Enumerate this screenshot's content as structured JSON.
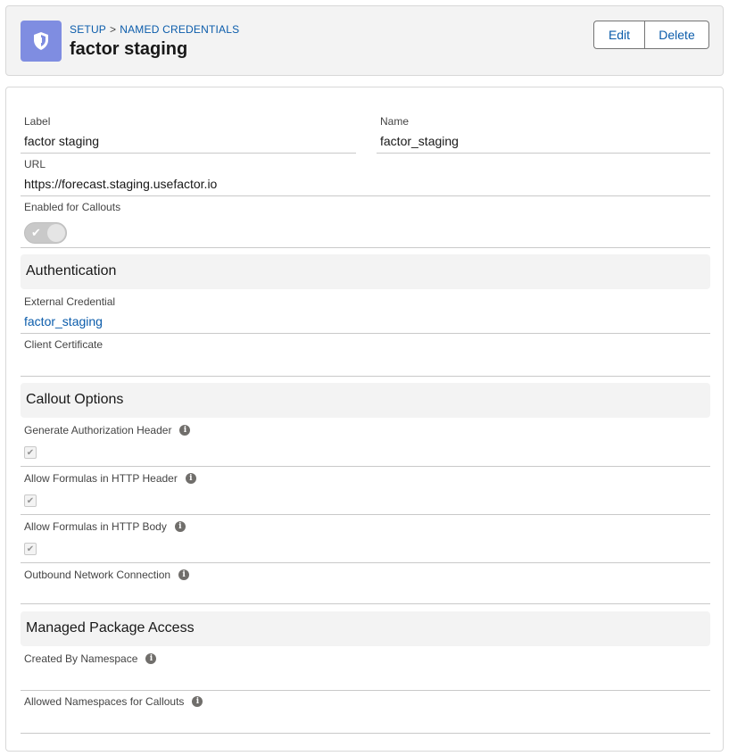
{
  "breadcrumb": {
    "setup": "SETUP",
    "separator": ">",
    "section": "NAMED CREDENTIALS"
  },
  "title": "factor staging",
  "buttons": {
    "edit": "Edit",
    "delete": "Delete"
  },
  "fields": {
    "label": {
      "label": "Label",
      "value": "factor staging"
    },
    "name": {
      "label": "Name",
      "value": "factor_staging"
    },
    "url": {
      "label": "URL",
      "value": "https://forecast.staging.usefactor.io"
    },
    "enabled": {
      "label": "Enabled for Callouts",
      "checked": true
    }
  },
  "authentication": {
    "heading": "Authentication",
    "external_credential": {
      "label": "External Credential",
      "value": "factor_staging"
    },
    "client_certificate": {
      "label": "Client Certificate",
      "value": ""
    }
  },
  "callout_options": {
    "heading": "Callout Options",
    "gen_auth_header": {
      "label": "Generate Authorization Header",
      "checked": true
    },
    "formulas_header": {
      "label": "Allow Formulas in HTTP Header",
      "checked": true
    },
    "formulas_body": {
      "label": "Allow Formulas in HTTP Body",
      "checked": true
    },
    "outbound_network": {
      "label": "Outbound Network Connection",
      "value": ""
    }
  },
  "managed_package": {
    "heading": "Managed Package Access",
    "created_by_namespace": {
      "label": "Created By Namespace",
      "value": ""
    },
    "allowed_namespaces": {
      "label": "Allowed Namespaces for Callouts",
      "value": ""
    }
  },
  "icons": {
    "app": "shield-icon",
    "info": "info-icon",
    "check": "check-icon"
  },
  "colors": {
    "brand_icon": "#7f8de1",
    "link": "#0b5cab",
    "section_bg": "#f3f3f3"
  }
}
